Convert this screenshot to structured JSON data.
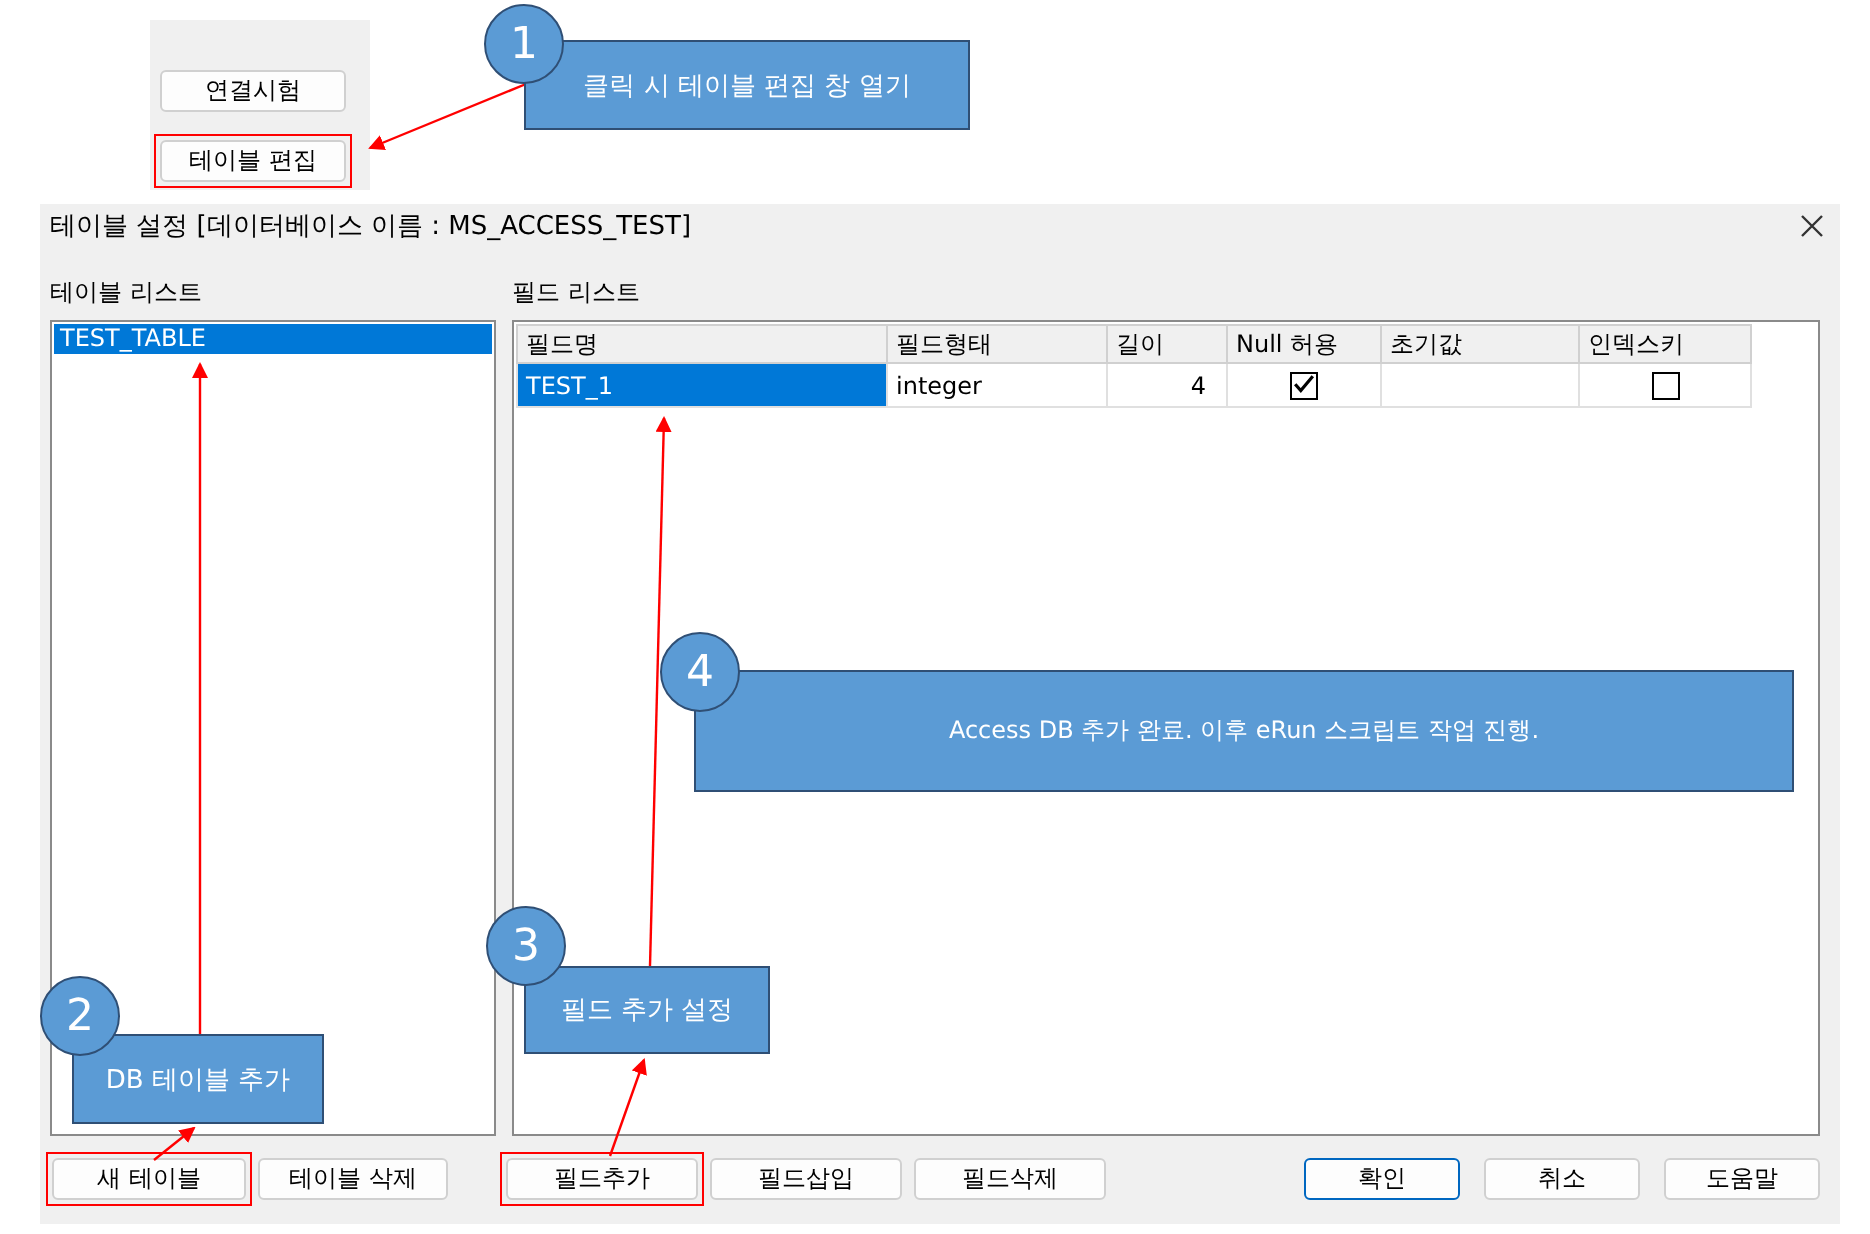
{
  "top_panel": {
    "buttons": [
      {
        "label": "연결시험",
        "highlight": false
      },
      {
        "label": "테이블 편집",
        "highlight": true
      }
    ]
  },
  "dialog": {
    "title": "테이블 설정 [데이터베이스 이름 : MS_ACCESS_TEST]",
    "table_list": {
      "label": "테이블 리스트",
      "items": [
        {
          "name": "TEST_TABLE",
          "selected": true
        }
      ]
    },
    "field_list": {
      "label": "필드 리스트",
      "columns": [
        "필드명",
        "필드형태",
        "길이",
        "Null 허용",
        "초기값",
        "인덱스키"
      ],
      "rows": [
        {
          "selected": true,
          "name": "TEST_1",
          "type": "integer",
          "length": "4",
          "null_allowed": true,
          "index_key": false
        }
      ]
    },
    "table_buttons": [
      {
        "label": "새 테이블",
        "highlight": true
      },
      {
        "label": "테이블 삭제",
        "highlight": false
      }
    ],
    "field_buttons": [
      {
        "label": "필드추가",
        "highlight": true
      },
      {
        "label": "필드삽입",
        "highlight": false
      },
      {
        "label": "필드삭제",
        "highlight": false
      }
    ],
    "dialog_buttons": [
      {
        "label": "확인",
        "default": true
      },
      {
        "label": "취소",
        "default": false
      },
      {
        "label": "도움말",
        "default": false
      }
    ]
  },
  "callouts": [
    {
      "number": "1",
      "text": "클릭 시 테이블 편집 창 열기"
    },
    {
      "number": "2",
      "text": "DB 테이블 추가"
    },
    {
      "number": "3",
      "text": "필드 추가 설정"
    },
    {
      "number": "4",
      "text": "Access DB 추가 완료. 이후 eRun 스크립트 작업 진행."
    }
  ]
}
